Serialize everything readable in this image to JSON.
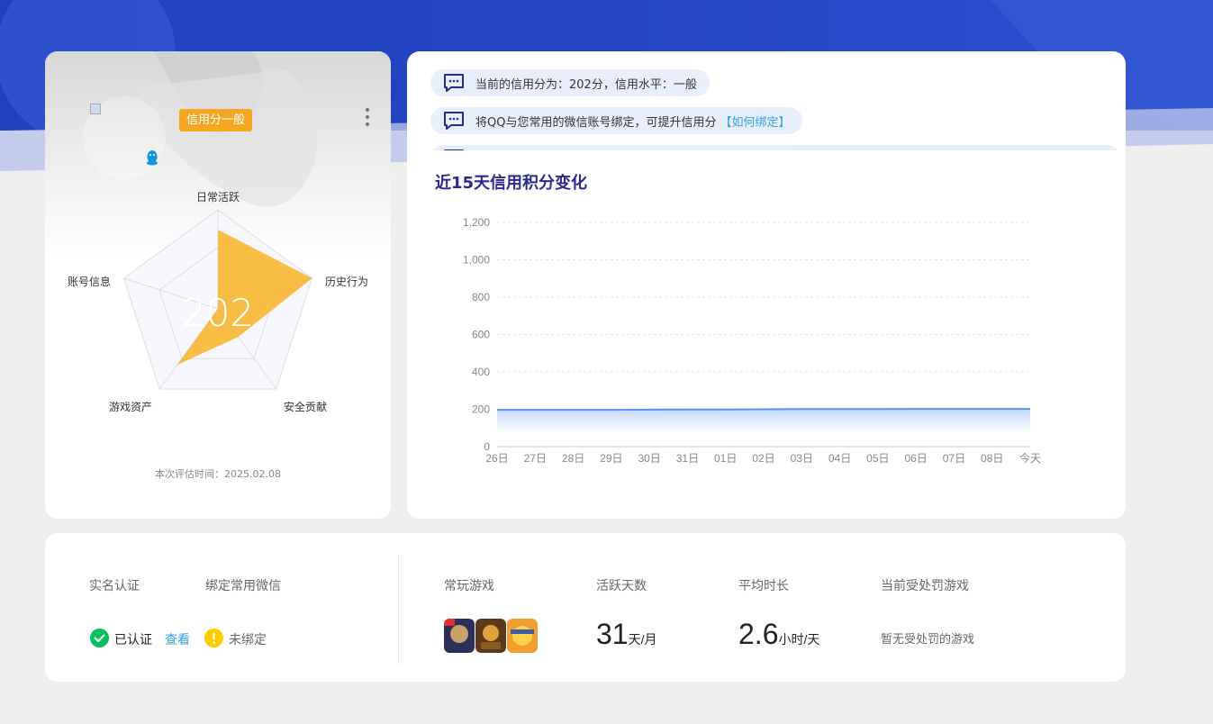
{
  "profile": {
    "credit_badge": "信用分一般",
    "score": "202",
    "radar_labels": {
      "top": "日常活跃",
      "right": "历史行为",
      "bottom_right": "安全贡献",
      "bottom_left": "游戏资产",
      "left": "账号信息"
    },
    "radar_values": {
      "daily_active": 0.8,
      "history_behavior": 1.0,
      "security_contribution": 0.35,
      "game_assets": 0.7,
      "account_info": 0.0
    },
    "eval_time": "本次评估时间：2025.02.08"
  },
  "notices": [
    {
      "text": "当前的信用分为：202分，信用水平：一般",
      "link": ""
    },
    {
      "text": "将QQ与您常用的微信账号绑定，可提升信用分",
      "link": "【如何绑定】"
    }
  ],
  "chart_title": "近15天信用积分变化",
  "chart_data": {
    "type": "area",
    "x": [
      "26日",
      "27日",
      "28日",
      "29日",
      "30日",
      "31日",
      "01日",
      "02日",
      "03日",
      "04日",
      "05日",
      "06日",
      "07日",
      "08日",
      "今天"
    ],
    "values": [
      197,
      197,
      197,
      197,
      198,
      199,
      199,
      200,
      201,
      201,
      201,
      202,
      202,
      202,
      202
    ],
    "y_ticks": [
      "0",
      "200",
      "400",
      "600",
      "800",
      "1,000",
      "1,200"
    ],
    "ylim": [
      0,
      1200
    ],
    "grid": true,
    "line_color": "#5b8ff9"
  },
  "stats": {
    "real_name_label": "实名认证",
    "wechat_label": "绑定常用微信",
    "real_name_status": "已认证",
    "view_link": "查看",
    "wechat_status": "未绑定",
    "games_label": "常玩游戏",
    "active_days_label": "活跃天数",
    "active_days_value": "31",
    "active_days_unit": "天/月",
    "avg_duration_label": "平均时长",
    "avg_duration_value": "2.6",
    "avg_duration_unit": "小时/天",
    "penalty_label": "当前受处罚游戏",
    "penalty_value": "暂无受处罚的游戏"
  }
}
